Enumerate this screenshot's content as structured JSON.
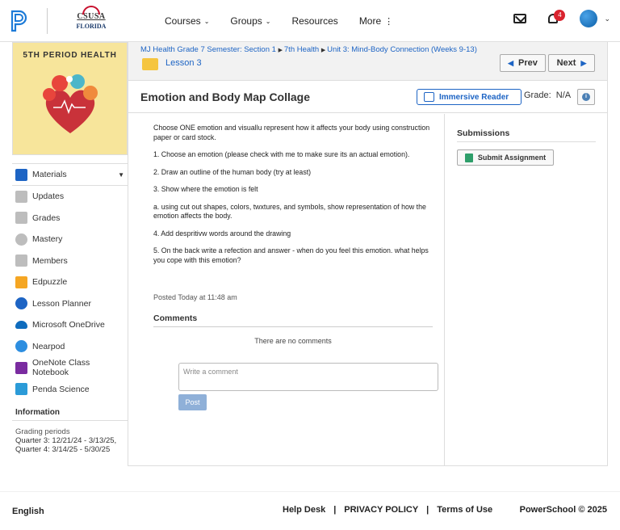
{
  "header": {
    "school_line1": "CSUSA",
    "school_line2": "FLORIDA",
    "nav": [
      {
        "label": "Courses",
        "has_caret": true
      },
      {
        "label": "Groups",
        "has_caret": true
      },
      {
        "label": "Resources",
        "has_caret": false
      },
      {
        "label": "More",
        "has_caret": false
      }
    ],
    "notification_count": "4"
  },
  "course": {
    "image_title": "5TH PERIOD HEALTH"
  },
  "sidebar": {
    "items": [
      {
        "label": "Materials",
        "icon": "materials-icon",
        "color": "#1d64c4"
      },
      {
        "label": "Updates",
        "icon": "updates-icon",
        "color": "#9e9e9e"
      },
      {
        "label": "Grades",
        "icon": "grades-icon",
        "color": "#9e9e9e"
      },
      {
        "label": "Mastery",
        "icon": "mastery-icon",
        "color": "#9e9e9e"
      },
      {
        "label": "Members",
        "icon": "members-icon",
        "color": "#9e9e9e"
      },
      {
        "label": "Edpuzzle",
        "icon": "edpuzzle-icon",
        "color": "#f5a623"
      },
      {
        "label": "Lesson Planner",
        "icon": "lesson-planner-icon",
        "color": "#1d64c4"
      },
      {
        "label": "Microsoft OneDrive",
        "icon": "onedrive-icon",
        "color": "#0f6cbd"
      },
      {
        "label": "Nearpod",
        "icon": "nearpod-icon",
        "color": "#2d8ee0"
      },
      {
        "label": "OneNote Class Notebook",
        "icon": "onenote-icon",
        "color": "#7a2ca0"
      },
      {
        "label": "Penda Science",
        "icon": "penda-icon",
        "color": "#2b9bd8"
      }
    ],
    "info_heading": "Information",
    "info_label": "Grading periods",
    "info_lines": [
      "Quarter 3: 12/21/24 - 3/13/25,",
      "Quarter 4: 3/14/25 - 5/30/25"
    ]
  },
  "breadcrumb": {
    "parts": [
      "MJ Health Grade 7 Semester: Section 1",
      "7th Health",
      "Unit 3: Mind-Body Connection (Weeks 9-13)"
    ],
    "folder": "Lesson 3",
    "prev": "Prev",
    "next": "Next"
  },
  "assignment": {
    "title": "Emotion and Body Map Collage",
    "immersive_reader": "Immersive Reader",
    "grade_label": "Grade:",
    "grade_value": "N/A",
    "paragraphs": [
      "Choose ONE emotion and visuallu represent how it affects your body using construction paper or card stock.",
      "1. Choose an emotion (please check with me to make sure its an actual emotion).",
      "2. Draw an outline of the human body (try at least)",
      "3. Show where the emotion is felt",
      "a. using cut out shapes, colors, twxtures, and symbols, show representation of how the emotion affects the body.",
      "4. Add despritivw words around the drawing",
      "5. On the back write a refection and answer - when do you feel this emotion. what helps you cope with this emotion?"
    ],
    "posted": "Posted Today at 11:48 am",
    "comments_heading": "Comments",
    "no_comments": "There are no comments",
    "comment_placeholder": "Write a comment",
    "post_label": "Post"
  },
  "submissions": {
    "heading": "Submissions",
    "submit_label": "Submit Assignment"
  },
  "footer": {
    "language": "English",
    "links": [
      "Help Desk",
      "|",
      "PRIVACY POLICY",
      "|",
      "Terms of Use"
    ],
    "copyright": "PowerSchool © 2025"
  }
}
